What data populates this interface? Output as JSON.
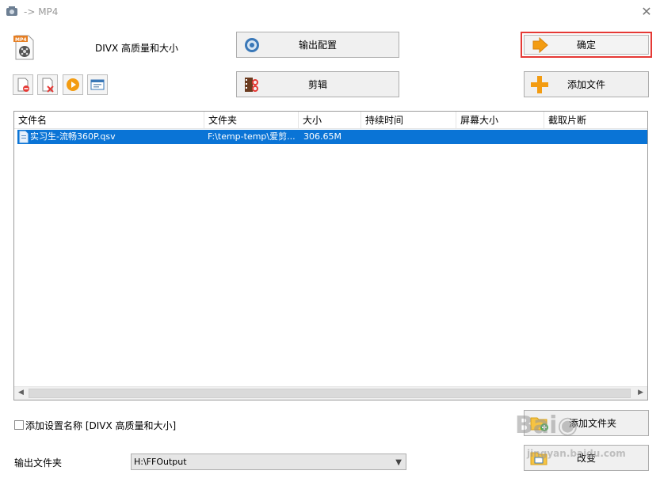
{
  "window": {
    "title": "-> MP4",
    "close_glyph": "✕"
  },
  "preset": {
    "label": "DIVX 高质量和大小",
    "icon": "mp4-file-icon"
  },
  "buttons": {
    "output_config": "输出配置",
    "ok": "确定",
    "clip": "剪辑",
    "add_file": "添加文件",
    "add_folder": "添加文件夹",
    "change": "改变"
  },
  "file_list": {
    "columns": [
      "文件名",
      "文件夹",
      "大小",
      "持续时间",
      "屏幕大小",
      "截取片断"
    ],
    "rows": [
      {
        "name": "实习生-流畅360P.qsv",
        "folder": "F:\\temp-temp\\爱剪...",
        "size": "306.65M",
        "duration": "",
        "screen_size": "",
        "clip": ""
      }
    ]
  },
  "options": {
    "add_setting_name_label": "添加设置名称 [DIVX 高质量和大小]",
    "checked": false
  },
  "output_folder": {
    "label": "输出文件夹",
    "value": "H:\\FFOutput"
  },
  "colors": {
    "selection": "#0a74d6",
    "highlight_border": "#e53935",
    "accent_orange": "#f39c12"
  }
}
